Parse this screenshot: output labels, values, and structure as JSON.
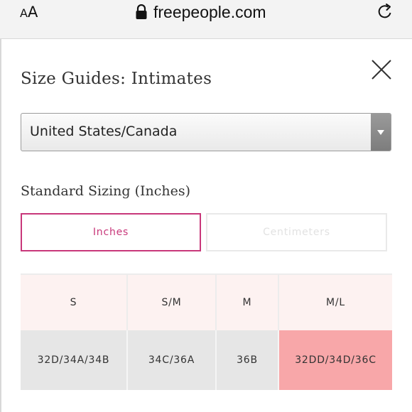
{
  "browser": {
    "text_size_label_small": "A",
    "text_size_label_big": "A",
    "host": "freepeople.com"
  },
  "modal": {
    "title": "Size Guides: Intimates",
    "region_select": {
      "selected": "United States/Canada"
    },
    "subtitle": "Standard Sizing (Inches)",
    "units": [
      {
        "label": "Inches",
        "active": true
      },
      {
        "label": "Centimeters",
        "active": false
      }
    ],
    "table": {
      "headers": [
        "S",
        "S/M",
        "M",
        "M/L"
      ],
      "row": [
        "32D/34A/34B",
        "34C/36A",
        "36B",
        "32DD/34D/36C"
      ],
      "highlighted_column": "M/L"
    }
  },
  "colors": {
    "accent": "#c8377a",
    "header_bg": "#fdf2f1",
    "cell_bg": "#e6e6e6",
    "highlight_bg": "#f8a7a9"
  },
  "icons": {
    "lock": "lock-icon",
    "reload": "reload-icon",
    "close": "close-icon",
    "dropdown": "chevron-down-icon"
  }
}
